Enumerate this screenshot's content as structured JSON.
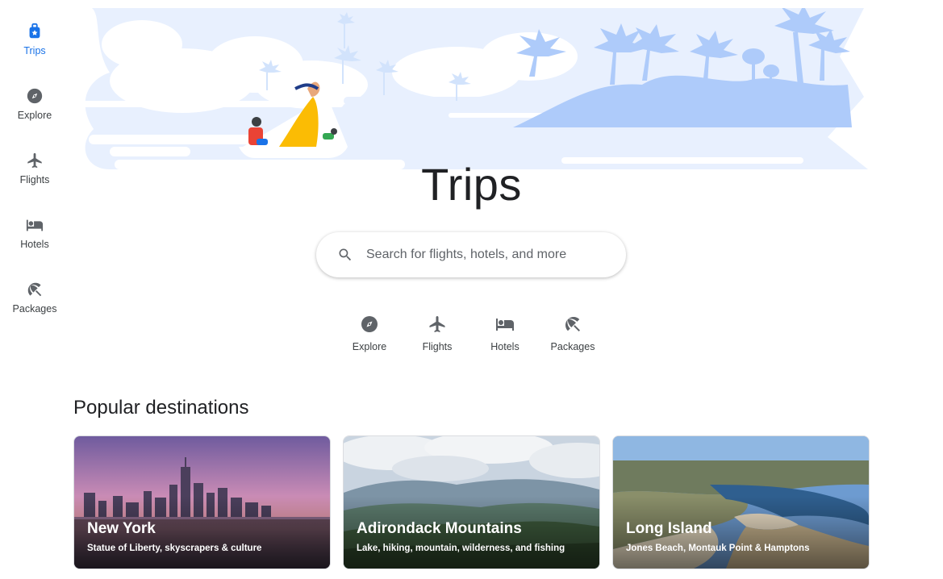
{
  "nav": {
    "items": [
      {
        "label": "Trips",
        "icon": "trips-icon",
        "active": true
      },
      {
        "label": "Explore",
        "icon": "compass-icon"
      },
      {
        "label": "Flights",
        "icon": "airplane-icon"
      },
      {
        "label": "Hotels",
        "icon": "bed-icon"
      },
      {
        "label": "Packages",
        "icon": "beach-umbrella-icon"
      }
    ]
  },
  "hero": {
    "title": "Trips"
  },
  "search": {
    "placeholder": "Search for flights, hotels, and more"
  },
  "quick_links": [
    {
      "label": "Explore",
      "icon": "compass-icon"
    },
    {
      "label": "Flights",
      "icon": "airplane-icon"
    },
    {
      "label": "Hotels",
      "icon": "bed-icon"
    },
    {
      "label": "Packages",
      "icon": "beach-umbrella-icon"
    }
  ],
  "popular": {
    "title": "Popular destinations",
    "cards": [
      {
        "name": "New York",
        "description": "Statue of Liberty, skyscrapers & culture"
      },
      {
        "name": "Adirondack Mountains",
        "description": "Lake, hiking, mountain, wilderness, and fishing"
      },
      {
        "name": "Long Island",
        "description": "Jones Beach, Montauk Point & Hamptons"
      }
    ]
  },
  "colors": {
    "accent": "#1a73e8",
    "icon": "#5f6368",
    "hero_light": "#e8f0fe",
    "hero_mid": "#aecbfa"
  }
}
